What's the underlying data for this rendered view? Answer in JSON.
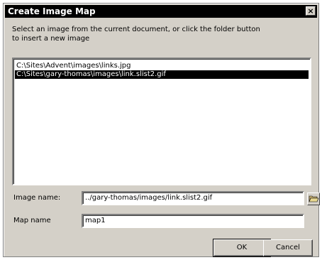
{
  "window": {
    "title": "Create Image Map",
    "close_glyph": "×"
  },
  "instructions": "Select an image from the current document, or click the folder button to insert a new image",
  "image_list": {
    "items": [
      {
        "path": "C:\\Sites\\Advent\\images\\links.jpg",
        "selected": false
      },
      {
        "path": "C:\\Sites\\gary-thomas\\images\\link.slist2.gif",
        "selected": true
      }
    ]
  },
  "fields": {
    "image_name_label": "Image name:",
    "image_name_value": "../gary-thomas/images/link.slist2.gif",
    "map_name_label": "Map name",
    "map_name_value": "map1"
  },
  "buttons": {
    "ok_label": "OK",
    "cancel_label": "Cancel"
  },
  "icons": {
    "close": "close-icon",
    "folder": "folder-open-icon"
  }
}
